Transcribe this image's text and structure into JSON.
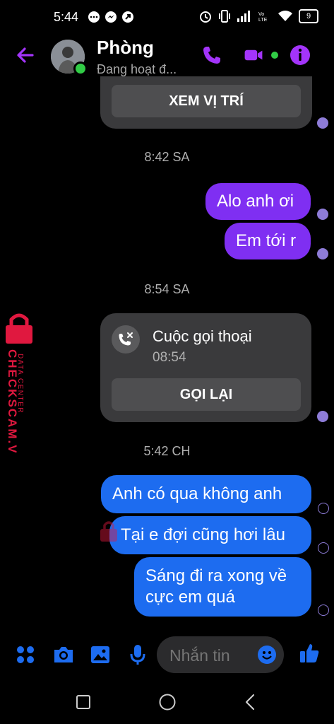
{
  "status_bar": {
    "time": "5:44",
    "battery": "9"
  },
  "header": {
    "name": "Phòng",
    "status": "Đang hoạt đ..."
  },
  "messages": {
    "location_button": "XEM VỊ TRÍ",
    "ts1": "8:42 SA",
    "m1": "Alo anh ơi",
    "m2": "Em tới r",
    "ts2": "8:54 SA",
    "call_title": "Cuộc gọi thoại",
    "call_time": "08:54",
    "call_back": "GỌI LẠI",
    "ts3": "5:42 CH",
    "m3": "Anh có qua không anh",
    "m4": "Tại e đợi cũng hơi lâu",
    "m5_line1": "Sáng đi ra xong về",
    "m5_line2": "cực em quá"
  },
  "watermark": {
    "line1": "DATA CENTER",
    "line2": "CHECKSCAM.VN"
  },
  "composer": {
    "placeholder": "Nhắn tin"
  },
  "colors": {
    "accent": "#a334fa",
    "sent_purple": "#7f2ff2",
    "sent_blue": "#1d6cf0",
    "online": "#31cc46"
  },
  "icons": [
    "back-arrow-icon",
    "phone-icon",
    "video-icon",
    "info-icon",
    "menu-dots-icon",
    "camera-icon",
    "image-icon",
    "mic-icon",
    "emoji-icon",
    "like-icon",
    "recent-apps-icon",
    "home-icon",
    "back-icon"
  ]
}
